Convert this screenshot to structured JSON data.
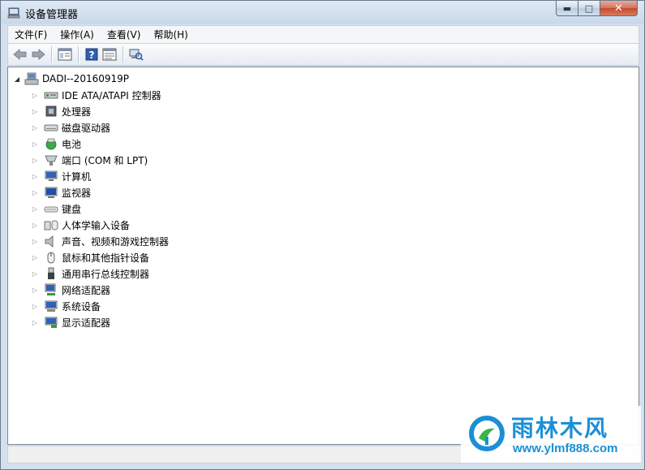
{
  "window": {
    "title": "设备管理器",
    "controls": {
      "minimize": "▬",
      "maximize": "□",
      "close": "✕"
    }
  },
  "menu": [
    {
      "label": "文件(F)"
    },
    {
      "label": "操作(A)"
    },
    {
      "label": "查看(V)"
    },
    {
      "label": "帮助(H)"
    }
  ],
  "toolbar": {
    "buttons": [
      "back-icon",
      "forward-icon",
      "properties-icon",
      "help-icon",
      "view-icon",
      "scan-hardware-icon"
    ]
  },
  "tree": {
    "root": {
      "label": "DADI--20160919P",
      "expand_glyph": "◢",
      "icon": "computer-icon"
    },
    "expand_glyph": "▷",
    "items": [
      {
        "label": "IDE ATA/ATAPI 控制器",
        "icon": "ide-controller-icon"
      },
      {
        "label": "处理器",
        "icon": "processor-icon"
      },
      {
        "label": "磁盘驱动器",
        "icon": "disk-drive-icon"
      },
      {
        "label": "电池",
        "icon": "battery-icon"
      },
      {
        "label": "端口 (COM 和 LPT)",
        "icon": "port-icon"
      },
      {
        "label": "计算机",
        "icon": "computer-icon"
      },
      {
        "label": "监视器",
        "icon": "monitor-icon"
      },
      {
        "label": "键盘",
        "icon": "keyboard-icon"
      },
      {
        "label": "人体学输入设备",
        "icon": "hid-icon"
      },
      {
        "label": "声音、视频和游戏控制器",
        "icon": "sound-icon"
      },
      {
        "label": "鼠标和其他指针设备",
        "icon": "mouse-icon"
      },
      {
        "label": "通用串行总线控制器",
        "icon": "usb-icon"
      },
      {
        "label": "网络适配器",
        "icon": "network-adapter-icon"
      },
      {
        "label": "系统设备",
        "icon": "system-device-icon"
      },
      {
        "label": "显示适配器",
        "icon": "display-adapter-icon"
      }
    ]
  },
  "watermark": {
    "title": "雨林木风",
    "url": "www.ylmf888.com"
  },
  "colors": {
    "accent": "#1b8fd6",
    "title_bar": "#c9d8ea",
    "close": "#c44a2f"
  }
}
